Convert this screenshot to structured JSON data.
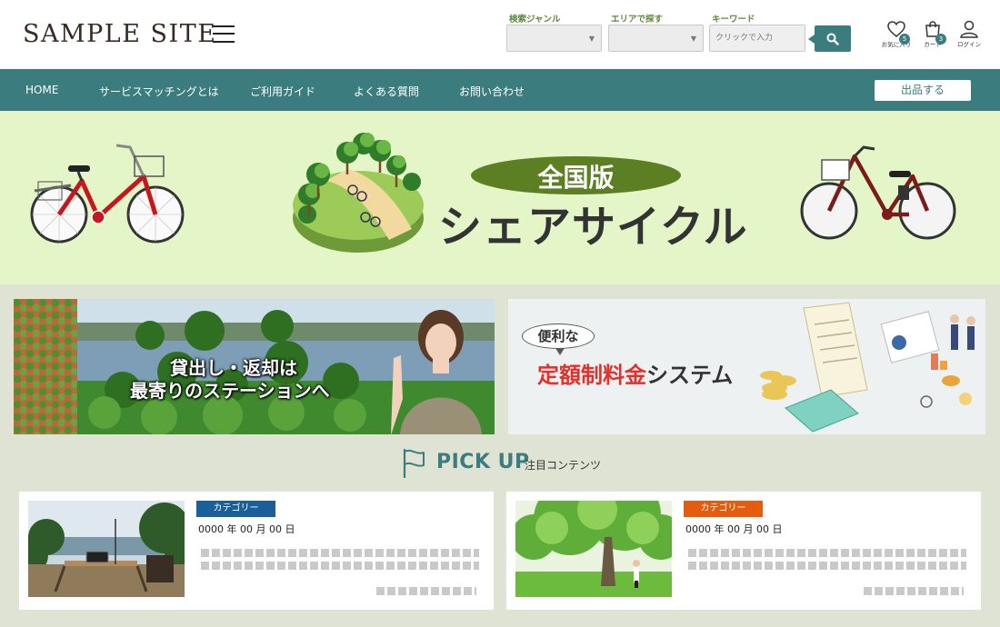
{
  "header": {
    "logo": "SAMPLE SITE",
    "search": {
      "genre_label": "検索ジャンル",
      "genre_value": "",
      "area_label": "エリアで探す",
      "area_value": "",
      "keyword_label": "キーワード",
      "keyword_placeholder": "クリックで入力"
    },
    "icons": [
      {
        "name": "heart-icon",
        "label": "お気に入り",
        "badge": "5"
      },
      {
        "name": "cart-icon",
        "label": "カート",
        "badge": "3"
      },
      {
        "name": "user-icon",
        "label": "ログイン"
      }
    ]
  },
  "nav": {
    "items": [
      "HOME",
      "サービスマッチングとは",
      "ご利用ガイド",
      "よくある質問",
      "お問い合わせ"
    ],
    "listing_button": "出品する"
  },
  "hero": {
    "pill_text": "全国版",
    "main_text": "シェアサイクル"
  },
  "banners": {
    "left_line1": "貸出し・返却は",
    "left_line2": "最寄りのステーションへ",
    "right_bubble": "便利な",
    "right_text_red": "定額制料金",
    "right_text_dark": "システム"
  },
  "pickup": {
    "title": "PICK UP",
    "subtitle": "注目コンテンツ"
  },
  "cards": [
    {
      "category": "カテゴリー",
      "category_color": "#1a5f9a",
      "date": "0000 年 00 月 00 日"
    },
    {
      "category": "カテゴリー",
      "category_color": "#e65c0f",
      "date": "0000 年 00 月 00 日"
    }
  ],
  "colors": {
    "accent": "#3b7c7f",
    "hero_bg": "#e4f6c8",
    "hero_pill": "#5c7f24",
    "page_bg": "#dfe3d4"
  }
}
